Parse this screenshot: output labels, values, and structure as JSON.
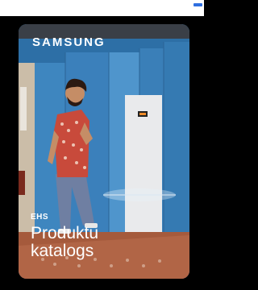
{
  "brand": {
    "name": "SAMSUNG"
  },
  "card": {
    "eyebrow": "EHS",
    "title_line1": "Produktu",
    "title_line2": "katalogs"
  },
  "colors": {
    "wall_blue": "#2d6fa6",
    "panel_blue": "#3e86bf",
    "panel_blue_light": "#4f95cc",
    "floor": "#a55a3c",
    "shirt": "#c84a3b",
    "pants": "#6f7fa2",
    "skin": "#c58d66",
    "hair": "#2c1a12",
    "top_accent": "#2f6fe0"
  }
}
